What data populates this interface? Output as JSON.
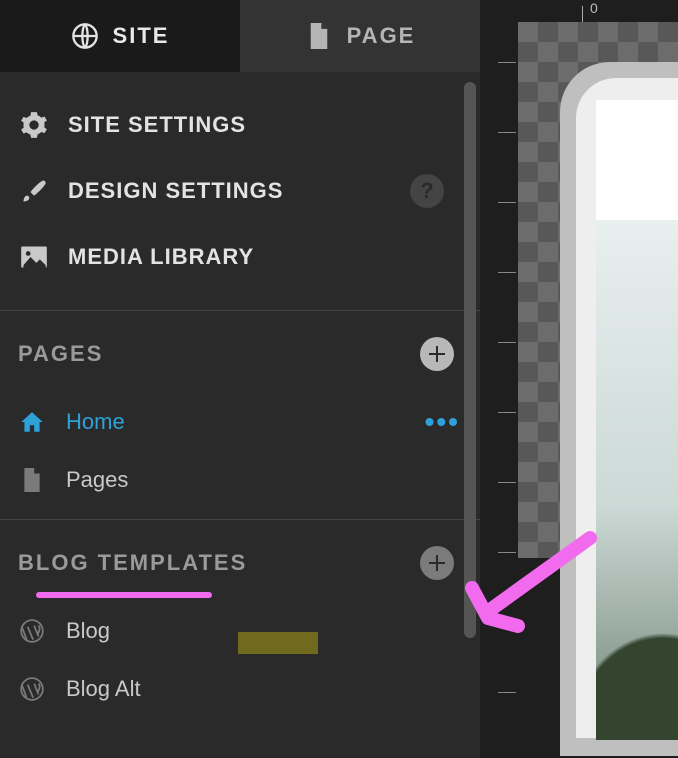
{
  "tabs": {
    "site": "SITE",
    "page": "PAGE"
  },
  "nav": {
    "site_settings": "SITE SETTINGS",
    "design_settings": "DESIGN SETTINGS",
    "media_library": "MEDIA LIBRARY",
    "help_glyph": "?"
  },
  "pages": {
    "title": "PAGES",
    "items": [
      {
        "label": "Home",
        "selected": true
      },
      {
        "label": "Pages",
        "selected": false
      }
    ]
  },
  "blog": {
    "title": "BLOG TEMPLATES",
    "items": [
      {
        "label": "Blog"
      },
      {
        "label": "Blog Alt"
      }
    ]
  },
  "ruler": {
    "top_value": "0"
  }
}
